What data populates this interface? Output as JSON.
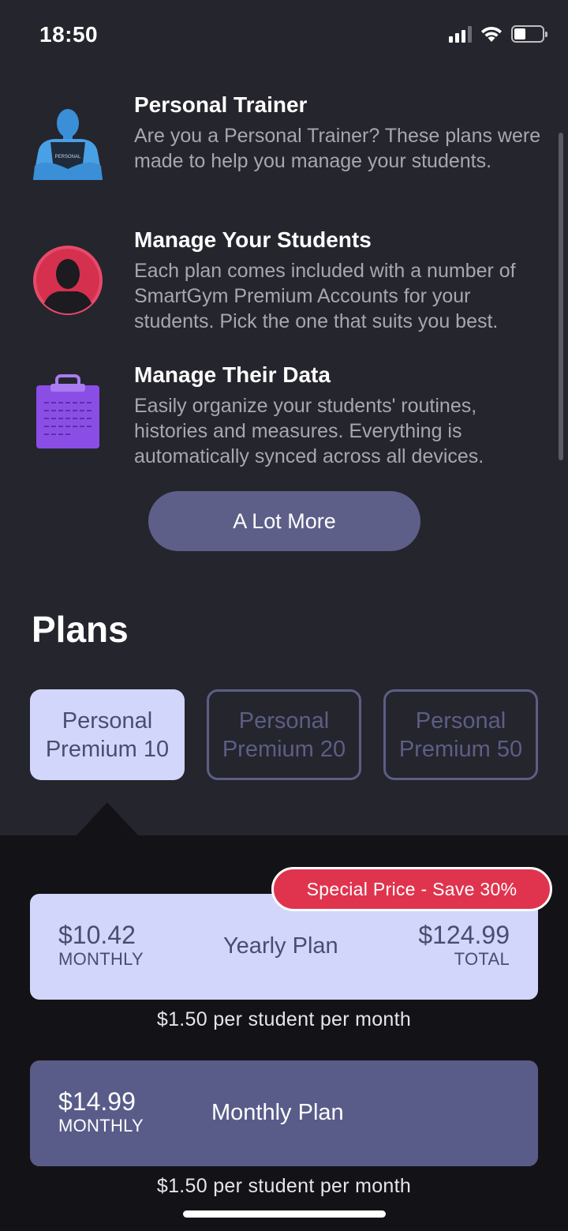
{
  "status_bar": {
    "time": "18:50"
  },
  "features": [
    {
      "icon": "trainer-icon",
      "title": "Personal Trainer",
      "description": "Are you a Personal Trainer? These plans were made to help you manage your students.",
      "shirt_text": "PERSONAL"
    },
    {
      "icon": "student-avatar-icon",
      "title": "Manage Your Students",
      "description": "Each plan comes included with a number of SmartGym Premium Accounts for your students. Pick the one that suits you best."
    },
    {
      "icon": "clipboard-icon",
      "title": "Manage Their Data",
      "description": "Easily organize your students' routines, histories and measures. Everything is automatically synced across all devices."
    }
  ],
  "more_button": "A Lot More",
  "plans_title": "Plans",
  "plan_tabs": [
    {
      "label": "Personal Premium 10",
      "selected": true
    },
    {
      "label": "Personal Premium 20",
      "selected": false
    },
    {
      "label": "Personal Premium 50",
      "selected": false
    }
  ],
  "yearly": {
    "badge": "Special Price - Save 30%",
    "monthly_price": "$10.42",
    "monthly_label": "MONTHLY",
    "plan_name": "Yearly Plan",
    "total_price": "$124.99",
    "total_label": "TOTAL",
    "per_student": "$1.50 per student per month"
  },
  "monthly": {
    "monthly_price": "$14.99",
    "monthly_label": "MONTHLY",
    "plan_name": "Monthly Plan",
    "per_student": "$1.50 per student per month"
  },
  "colors": {
    "background": "#25252d",
    "lower_panel": "#131317",
    "accent_light": "#d2d6fb",
    "accent_dark": "#595c89",
    "badge_red": "#e0344e"
  }
}
